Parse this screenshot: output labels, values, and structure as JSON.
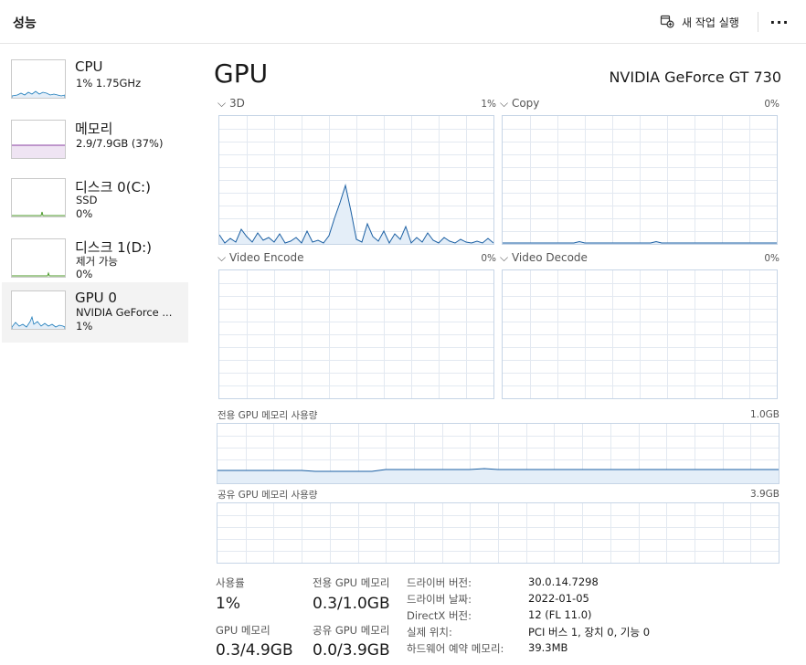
{
  "header": {
    "title": "성능",
    "new_task_label": "새 작업 실행",
    "more_label": "···"
  },
  "sidebar": {
    "items": [
      {
        "title": "CPU",
        "sub1": "1% 1.75GHz",
        "sub2": "",
        "color": "#1a7ab9"
      },
      {
        "title": "메모리",
        "sub1": "2.9/7.9GB (37%)",
        "sub2": "",
        "color": "#8a3fa0"
      },
      {
        "title": "디스크 0(C:)",
        "sub1": "SSD",
        "sub2": "0%",
        "color": "#4c9a2a"
      },
      {
        "title": "디스크 1(D:)",
        "sub1": "제거 가능",
        "sub2": "0%",
        "color": "#4c9a2a"
      },
      {
        "title": "GPU 0",
        "sub1": "NVIDIA GeForce ...",
        "sub2": "1%",
        "color": "#1a7ab9"
      }
    ],
    "selected": 4
  },
  "main": {
    "heading": "GPU",
    "model": "NVIDIA GeForce GT 730",
    "engines": [
      {
        "name": "3D",
        "pct": "1%"
      },
      {
        "name": "Copy",
        "pct": "0%"
      },
      {
        "name": "Video Encode",
        "pct": "0%"
      },
      {
        "name": "Video Decode",
        "pct": "0%"
      }
    ],
    "dedicated_mem": {
      "label": "전용 GPU 메모리 사용량",
      "max": "1.0GB"
    },
    "shared_mem": {
      "label": "공유 GPU 메모리 사용량",
      "max": "3.9GB"
    }
  },
  "stats": {
    "usage_label": "사용률",
    "usage_value": "1%",
    "dedicated_label": "전용 GPU 메모리",
    "dedicated_value": "0.3/1.0GB",
    "gpu_mem_label": "GPU 메모리",
    "gpu_mem_value": "0.3/4.9GB",
    "shared_label": "공유 GPU 메모리",
    "shared_value": "0.0/3.9GB"
  },
  "info": [
    {
      "key": "드라이버 버전:",
      "value": "30.0.14.7298"
    },
    {
      "key": "드라이버 날짜:",
      "value": "2022-01-05"
    },
    {
      "key": "DirectX 버전:",
      "value": "12 (FL 11.0)"
    },
    {
      "key": "실제 위치:",
      "value": "PCI 버스 1, 장치 0, 기능 0"
    },
    {
      "key": "하드웨어 예약 메모리:",
      "value": "39.3MB"
    }
  ],
  "colors": {
    "gpu_line": "#1a5fa3",
    "gpu_fill": "#e4eef8",
    "grid": "#e3e9f1",
    "memory": "#8a3fa0",
    "disk": "#4c9a2a"
  },
  "icons": {
    "new_task": "new-task-icon",
    "more": "more-options-icon",
    "collapse": "chevron-down-icon"
  }
}
